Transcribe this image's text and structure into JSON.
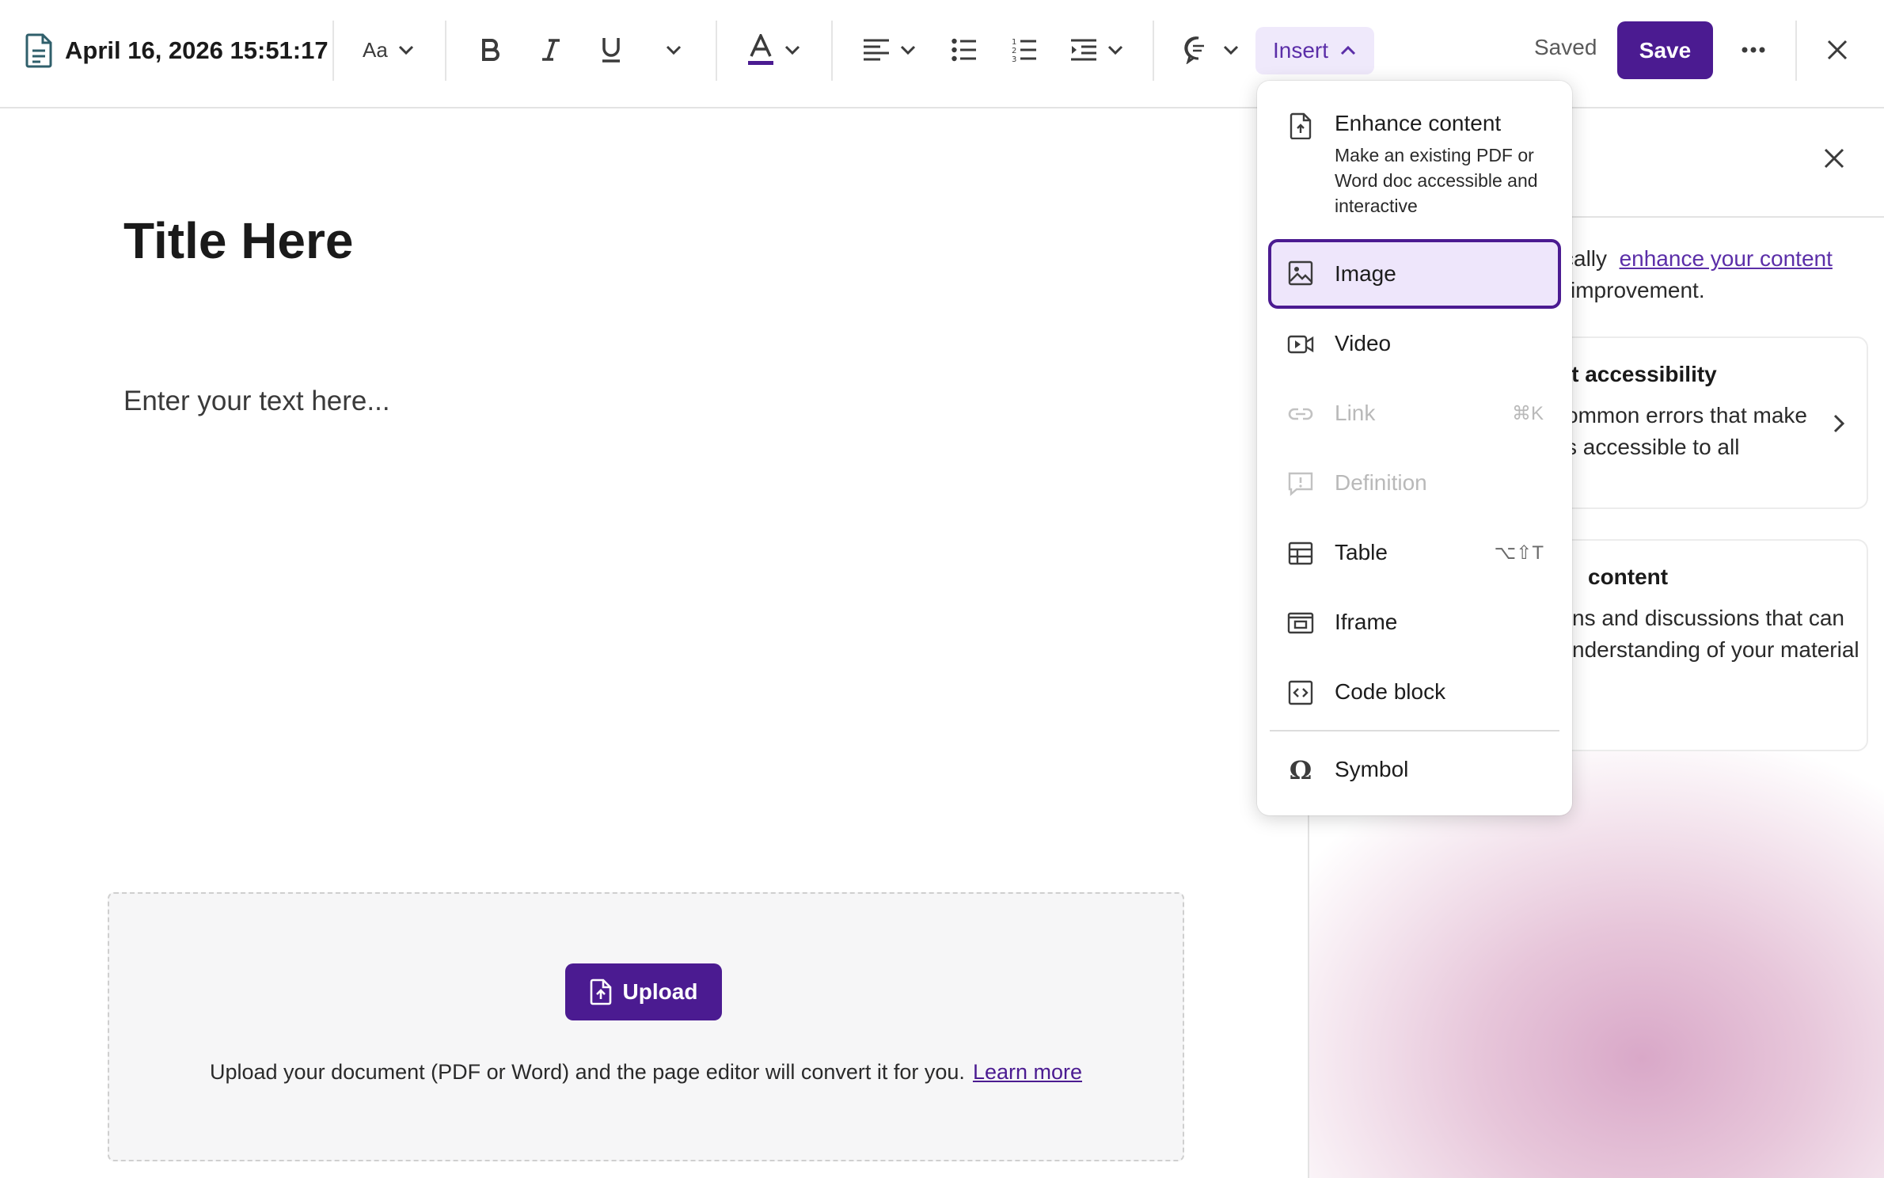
{
  "toolbar": {
    "doc_title": "April 16, 2026 15:51:17",
    "font_size_label": "Aa",
    "insert_label": "Insert",
    "saved_status": "Saved",
    "save_label": "Save"
  },
  "editor": {
    "title": "Title Here",
    "body_placeholder": "Enter your text here...",
    "upload": {
      "button_label": "Upload",
      "help_text": "Upload your document (PDF or Word) and the page editor will convert it for you.",
      "learn_more": "Learn more"
    }
  },
  "right_panel": {
    "intro_prefix": "cally",
    "intro_link": "enhance your content",
    "intro_suffix": "improvement.",
    "cards": [
      {
        "title": "nt accessibility",
        "desc_line1": "ommon errors that make",
        "desc_line2": "s accessible to all"
      },
      {
        "title": "content",
        "desc_line1": "ns and discussions that can",
        "desc_line2": "nderstanding of your material"
      }
    ]
  },
  "insert_menu": {
    "items": [
      {
        "label": "Enhance content",
        "sublabel": "Make an existing PDF or Word doc accessible and interactive",
        "icon": "file-upload-icon"
      },
      {
        "label": "Image",
        "icon": "image-icon",
        "selected": true
      },
      {
        "label": "Video",
        "icon": "video-icon"
      },
      {
        "label": "Link",
        "shortcut": "⌘K",
        "icon": "link-icon",
        "disabled": true
      },
      {
        "label": "Definition",
        "icon": "definition-icon",
        "disabled": true
      },
      {
        "label": "Table",
        "shortcut": "⌥⇧T",
        "icon": "table-icon"
      },
      {
        "label": "Iframe",
        "icon": "iframe-icon"
      },
      {
        "label": "Code block",
        "icon": "code-block-icon"
      },
      {
        "label": "Symbol",
        "icon": "omega-icon"
      }
    ]
  },
  "colors": {
    "primary": "#4b1b91",
    "menu_selected_bg": "#eee6fb",
    "insert_bg": "#efe9fb"
  }
}
